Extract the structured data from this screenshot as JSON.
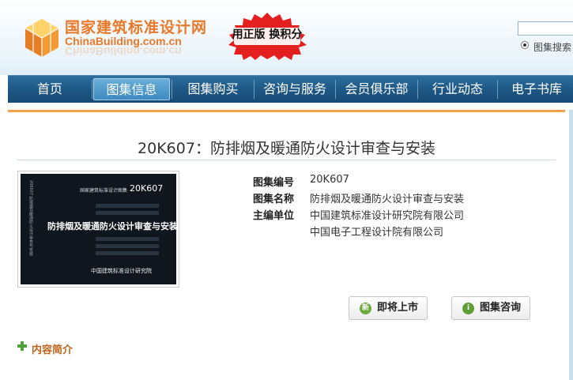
{
  "header": {
    "logo_cn": "国家建筑标准设计网",
    "logo_en": "ChinaBuilding.com.cn",
    "promo": "用正版 换积分",
    "search": {
      "placeholder": "",
      "option_label": "图集搜索"
    }
  },
  "nav": {
    "items": [
      {
        "label": "首页"
      },
      {
        "label": "图集信息",
        "active": true
      },
      {
        "label": "图集购买"
      },
      {
        "label": "咨询与服务"
      },
      {
        "label": "会员俱乐部"
      },
      {
        "label": "行业动态"
      },
      {
        "label": "电子书库"
      }
    ]
  },
  "product": {
    "title": "20K607：防排烟及暖通防火设计审查与安装",
    "cover": {
      "series": "国家建筑标准设计图集",
      "code": "20K607",
      "title": "防排烟及暖通防火设计审查与安装",
      "publisher": "中国建筑标准设计研究院",
      "spine": "20K607 防排烟及暖通防火设计审查与安装"
    },
    "meta": [
      {
        "label": "图集编号",
        "value": "20K607"
      },
      {
        "label": "图集名称",
        "value": "防排烟及暖通防火设计审查与安装"
      },
      {
        "label": "主编单位",
        "value": "中国建筑标准设计研究院有限公司"
      }
    ],
    "meta_extra": "中国电子工程设计院有限公司",
    "buttons": {
      "coming_soon": {
        "label": "即将上市",
        "icon": "new-icon",
        "color": "#6aa93c"
      },
      "consult": {
        "label": "图集咨询",
        "icon": "info-icon",
        "color": "#5e9e37"
      }
    },
    "intro_label": "内容简介"
  },
  "colors": {
    "nav_bg": "#1f5886",
    "nav_active": "#4a95c9",
    "logo_orange": "#e8792b",
    "promo_red": "#e41f1f",
    "content_accent": "#f0a34a",
    "intro_color": "#c0621a"
  }
}
